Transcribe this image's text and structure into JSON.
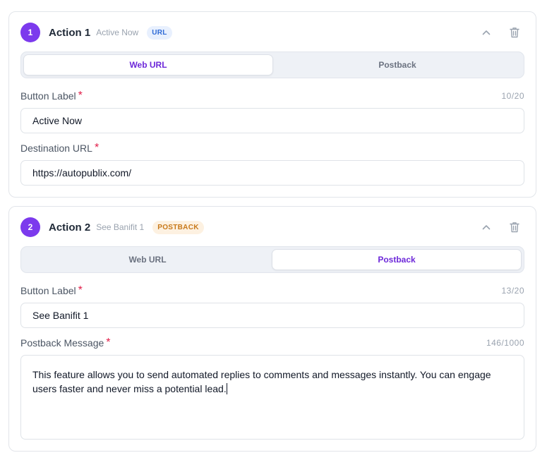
{
  "actions": [
    {
      "number": "1",
      "title": "Action 1",
      "subtitle": "Active Now",
      "badge": "URL",
      "tabs": {
        "web_url": "Web URL",
        "postback": "Postback"
      },
      "selected_tab": "Web URL",
      "button_label": {
        "label": "Button Label",
        "required_mark": "*",
        "count": "10/20",
        "value": "Active Now"
      },
      "destination_url": {
        "label": "Destination URL",
        "required_mark": "*",
        "value": "https://autopublix.com/"
      }
    },
    {
      "number": "2",
      "title": "Action 2",
      "subtitle": "See Banifit 1",
      "badge": "POSTBACK",
      "tabs": {
        "web_url": "Web URL",
        "postback": "Postback"
      },
      "selected_tab": "Postback",
      "button_label": {
        "label": "Button Label",
        "required_mark": "*",
        "count": "13/20",
        "value": "See Banifit 1"
      },
      "postback_message": {
        "label": "Postback Message",
        "required_mark": "*",
        "count": "146/1000",
        "value": "This feature allows you to send automated replies to comments and messages instantly. You can engage users faster and never miss a potential lead."
      }
    }
  ],
  "icons": {
    "collapse": "chevron-up-icon",
    "delete": "trash-icon"
  },
  "colors": {
    "accent": "#7c3aed",
    "url_badge": "#2f6bd6",
    "postback_badge": "#c8791a",
    "required": "#e11d48"
  }
}
